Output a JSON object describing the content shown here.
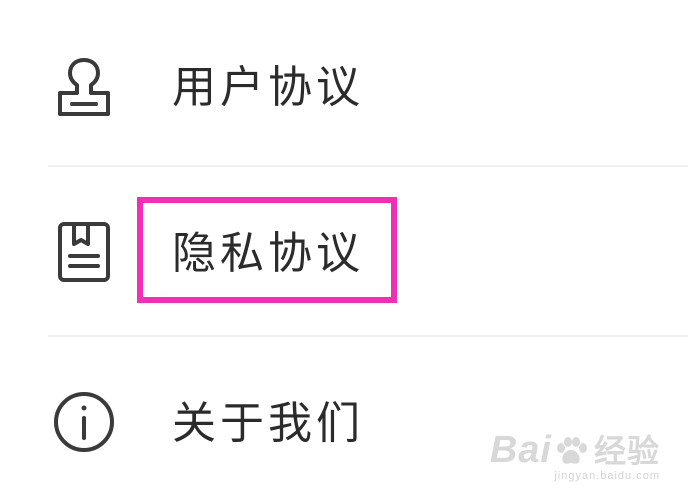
{
  "menu": {
    "items": [
      {
        "label": "用户协议",
        "icon": "stamp-icon"
      },
      {
        "label": "隐私协议",
        "icon": "document-icon"
      },
      {
        "label": "关于我们",
        "icon": "info-icon"
      }
    ]
  },
  "highlight": {
    "color": "#f02fb4",
    "target": "隐私协议"
  },
  "watermark": {
    "brand_left": "Bai",
    "brand_right": "经验",
    "url": "jingyan.baidu.com"
  }
}
